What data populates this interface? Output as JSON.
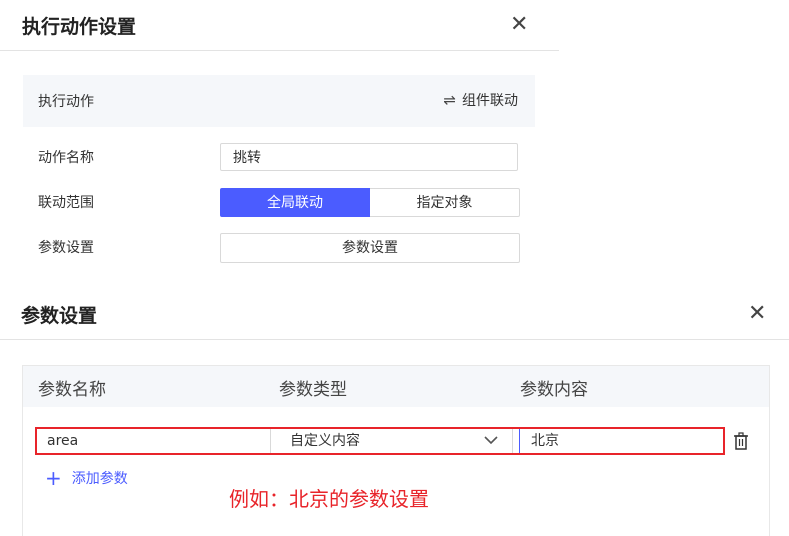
{
  "top_panel": {
    "title": "执行动作设置",
    "close_glyph": "✕",
    "header": {
      "label": "执行动作",
      "link_icon": "⇌",
      "link_label": "组件联动"
    },
    "rows": {
      "action_name_label": "动作名称",
      "action_name_value": "挑转",
      "scope_label": "联动范围",
      "scope_options": [
        "全局联动",
        "指定对象"
      ],
      "scope_selected": "全局联动",
      "param_label": "参数设置",
      "param_button": "参数设置"
    }
  },
  "bottom_panel": {
    "title": "参数设置",
    "close_glyph": "✕",
    "columns": [
      "参数名称",
      "参数类型",
      "参数内容"
    ],
    "row": {
      "name": "area",
      "type": "自定义内容",
      "content": "北京"
    },
    "add_label": "添加参数",
    "add_icon": "+",
    "note": "例如：北京的参数设置"
  },
  "colors": {
    "accent": "#4b5cff",
    "highlight": "#e8242a",
    "header_bg": "#f5f7fa"
  }
}
